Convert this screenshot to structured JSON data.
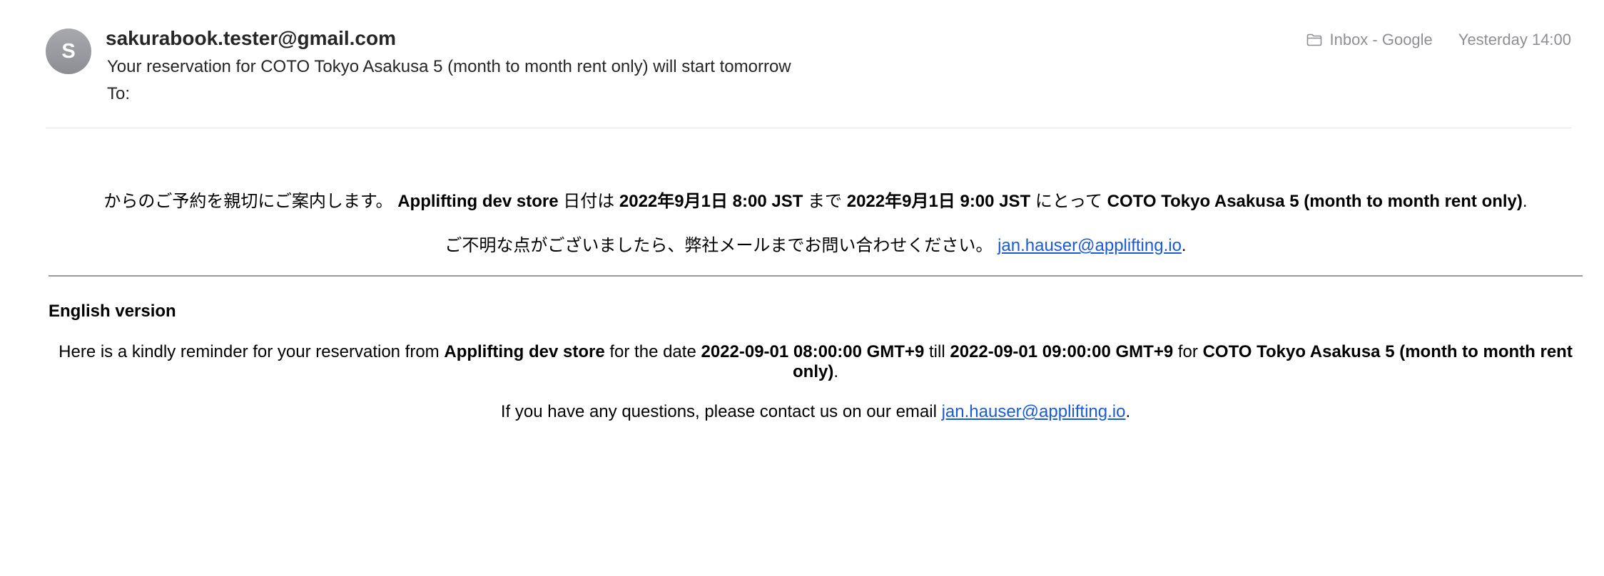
{
  "message": {
    "sender_initial": "S",
    "sender": "sakurabook.tester@gmail.com",
    "subject": "Your reservation for COTO Tokyo Asakusa 5 (month to month rent only) will start tomorrow",
    "to_label": "To:",
    "mailbox_icon": "folder-icon",
    "mailbox": "Inbox - Google",
    "timestamp": "Yesterday 14:00"
  },
  "body": {
    "jp": {
      "intro": "からのご予約を親切にご案内します。",
      "store": "Applifting dev store",
      "date_word": "日付は",
      "start": "2022年9月1日 8:00 JST",
      "until_word": "まで",
      "end": "2022年9月1日 9:00 JST",
      "for_word": "にとって",
      "venue": "COTO Tokyo Asakusa 5 (month to month rent only)",
      "period": ".",
      "contact_text": "ご不明な点がございましたら、弊社メールまでお問い合わせください。",
      "email": "jan.hauser@applifting.io",
      "contact_period": "."
    },
    "en": {
      "heading": "English version",
      "intro": "Here is a kindly reminder for your reservation from",
      "store": "Applifting dev store",
      "date_word": "for the date",
      "start": "2022-09-01 08:00:00 GMT+9",
      "till_word": "till",
      "end": "2022-09-01 09:00:00 GMT+9",
      "for_word": "for",
      "venue": "COTO Tokyo Asakusa 5 (month to month rent only)",
      "period": ".",
      "contact_text": "If you have any questions, please contact us on our email",
      "email": "jan.hauser@applifting.io",
      "contact_period": "."
    }
  },
  "colors": {
    "link": "#1a5ad6",
    "meta": "#8e8e93",
    "avatar": "#9b9da2"
  }
}
